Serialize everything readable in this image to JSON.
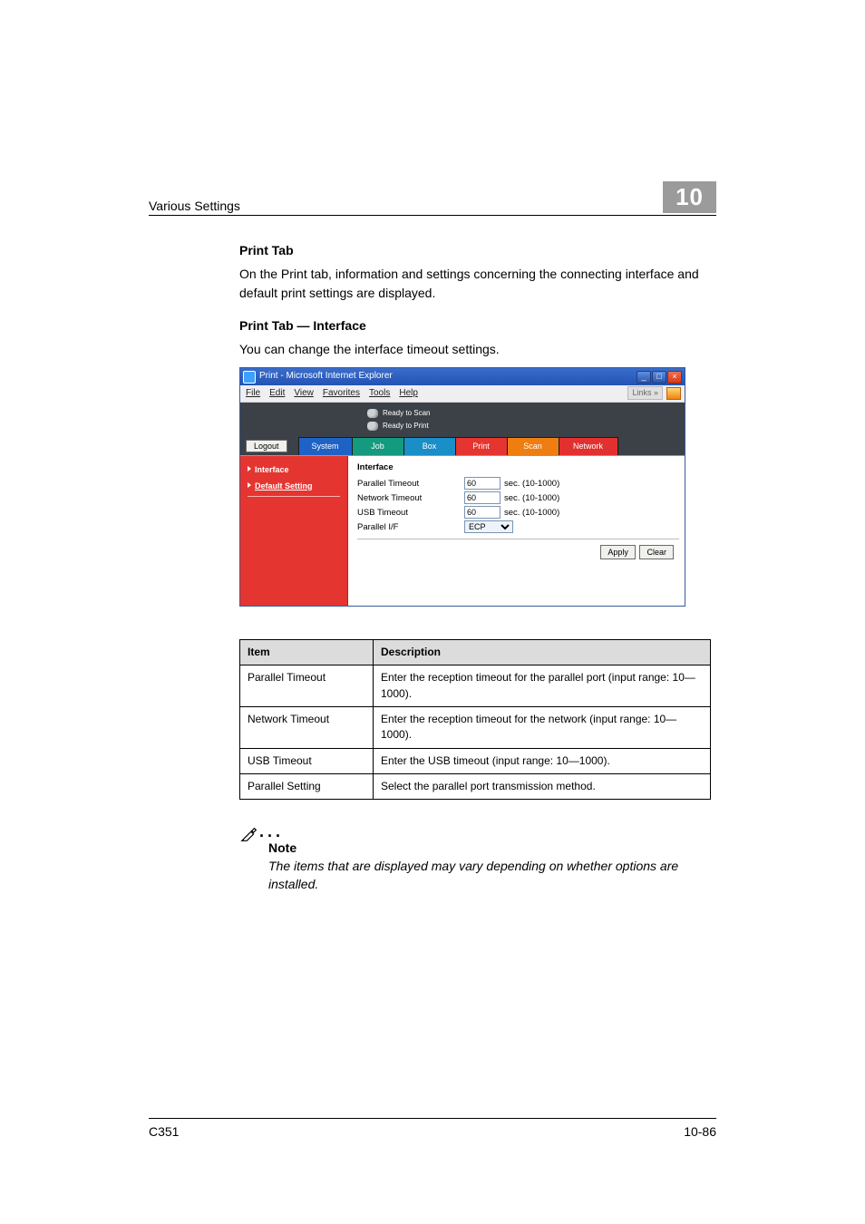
{
  "header": {
    "title": "Various Settings",
    "chapter_number": "10"
  },
  "section": {
    "h1": "Print Tab",
    "p1": "On the Print tab, information and settings concerning the connecting interface and default print settings are displayed.",
    "h2": "Print Tab — Interface",
    "p2": "You can change the interface timeout settings."
  },
  "screenshot": {
    "window_title": "Print - Microsoft Internet Explorer",
    "win_min": "_",
    "win_max": "□",
    "win_close": "×",
    "menu": {
      "file": "File",
      "edit": "Edit",
      "view": "View",
      "favorites": "Favorites",
      "tools": "Tools",
      "help": "Help"
    },
    "links_label": "Links",
    "links_chev": "»",
    "status": {
      "scan": "Ready to Scan",
      "print": "Ready to Print"
    },
    "logout": "Logout",
    "tabs": {
      "system": "System",
      "job": "Job",
      "box": "Box",
      "print": "Print",
      "scan": "Scan",
      "network": "Network"
    },
    "sidebar": {
      "interface": "Interface",
      "default_setting": "Default Setting"
    },
    "panel": {
      "title": "Interface",
      "rows": [
        {
          "label": "Parallel Timeout",
          "value": "60",
          "unit": "sec. (10-1000)"
        },
        {
          "label": "Network Timeout",
          "value": "60",
          "unit": "sec. (10-1000)"
        },
        {
          "label": "USB Timeout",
          "value": "60",
          "unit": "sec. (10-1000)"
        }
      ],
      "select_label": "Parallel I/F",
      "select_value": "ECP",
      "apply": "Apply",
      "clear": "Clear"
    }
  },
  "table": {
    "head_item": "Item",
    "head_desc": "Description",
    "rows": [
      {
        "item": "Parallel Timeout",
        "desc": "Enter the reception timeout for the parallel port (input range: 10—1000)."
      },
      {
        "item": "Network Timeout",
        "desc": "Enter the reception timeout for the network (input range: 10—1000)."
      },
      {
        "item": "USB Timeout",
        "desc": "Enter the USB timeout (input range: 10—1000)."
      },
      {
        "item": "Parallel Setting",
        "desc": "Select the parallel port transmission method."
      }
    ]
  },
  "note": {
    "heading": "Note",
    "text": "The items that are displayed may vary depending on whether options are installed."
  },
  "footer": {
    "left": "C351",
    "right": "10-86"
  },
  "chart_data": {
    "type": "table",
    "title": "Print Tab — Interface settings",
    "columns": [
      "Item",
      "Description"
    ],
    "rows": [
      [
        "Parallel Timeout",
        "Enter the reception timeout for the parallel port (input range: 10—1000)."
      ],
      [
        "Network Timeout",
        "Enter the reception timeout for the network (input range: 10—1000)."
      ],
      [
        "USB Timeout",
        "Enter the USB timeout (input range: 10—1000)."
      ],
      [
        "Parallel Setting",
        "Select the parallel port transmission method."
      ]
    ]
  }
}
